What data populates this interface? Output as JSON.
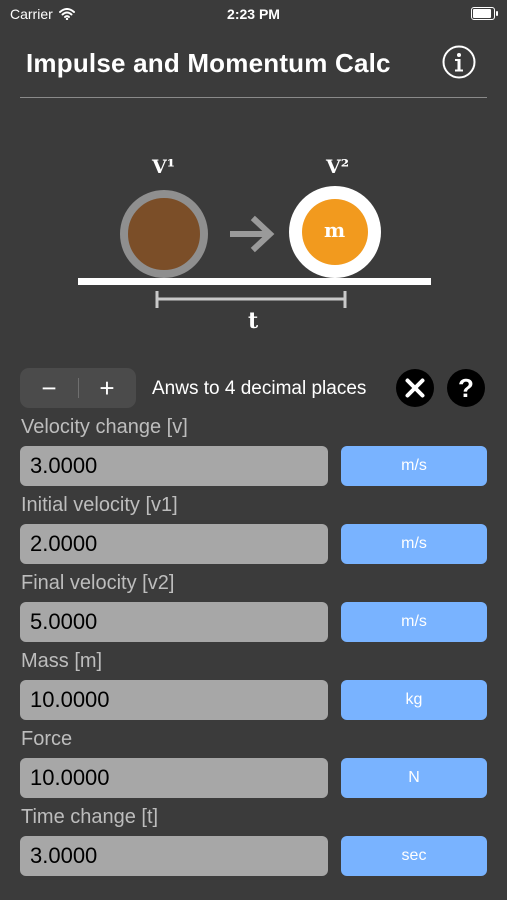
{
  "status_bar": {
    "carrier": "Carrier",
    "time": "2:23 PM",
    "battery_level": 1.0
  },
  "header": {
    "title": "Impulse and Momentum Calc",
    "info_icon": "info-icon"
  },
  "diagram": {
    "v1_label": "V¹",
    "v2_label": "V²",
    "mass_label": "m",
    "time_label": "t",
    "ball_color": "#7b4e28",
    "mass_color": "#f29a1e"
  },
  "controls": {
    "decrease_label": "−",
    "increase_label": "+",
    "decimals_text": "Anws to 4 decimal places",
    "clear_icon": "close-icon",
    "help_label": "?"
  },
  "fields": [
    {
      "label": "Velocity change [v]",
      "value": "3.0000",
      "unit": "m/s"
    },
    {
      "label": "Initial velocity [v1]",
      "value": "2.0000",
      "unit": "m/s"
    },
    {
      "label": "Final velocity [v2]",
      "value": "5.0000",
      "unit": "m/s"
    },
    {
      "label": "Mass [m]",
      "value": "10.0000",
      "unit": "kg"
    },
    {
      "label": "Force",
      "value": "10.0000",
      "unit": "N"
    },
    {
      "label": "Time change [t]",
      "value": "3.0000",
      "unit": "sec"
    }
  ],
  "colors": {
    "background": "#3b3b3b",
    "field": "#a7a7a7",
    "unit_button": "#79b3ff"
  }
}
